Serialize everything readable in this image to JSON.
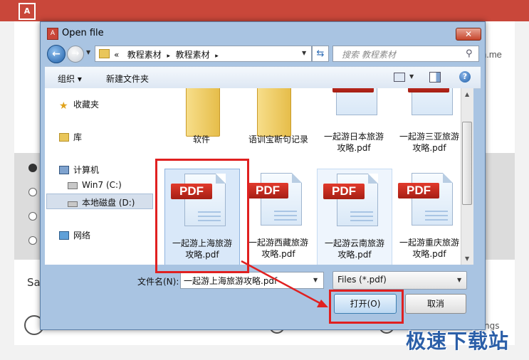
{
  "background_app": {
    "right_text": "n.me",
    "bottom_left_text": "Sa",
    "bottom_right_text": "ngs"
  },
  "dialog": {
    "title": "Open file",
    "close_label": "✕",
    "address": {
      "prefix": "«",
      "crumbs": [
        "教程素材",
        "教程素材"
      ],
      "separator": "▸"
    },
    "search_placeholder": "搜索 教程素材",
    "toolbar": {
      "organize_label": "组织 ▾",
      "new_folder_label": "新建文件夹"
    },
    "nav": {
      "favorites": "收藏夹",
      "libraries": "库",
      "computer": "计算机",
      "drive_c": "Win7 (C:)",
      "drive_d": "本地磁盘 (D:)",
      "network": "网络"
    },
    "files": [
      {
        "label": "软件",
        "type": "folder"
      },
      {
        "label": "语训宝断句记录",
        "type": "folder"
      },
      {
        "label": "一起游日本旅游攻略.pdf",
        "line1": "一起游日本旅游",
        "line2": "攻略.pdf",
        "type": "pdf"
      },
      {
        "label": "一起游三亚旅游攻略.pdf",
        "line1": "一起游三亚旅游",
        "line2": "攻略.pdf",
        "type": "pdf"
      },
      {
        "label": "一起游上海旅游攻略.pdf",
        "line1": "一起游上海旅游",
        "line2": "攻略.pdf",
        "type": "pdf",
        "selected": true
      },
      {
        "label": "一起游西藏旅游攻略.pdf",
        "line1": "一起游西藏旅游",
        "line2": "攻略.pdf",
        "type": "pdf"
      },
      {
        "label": "一起游云南旅游攻略.pdf",
        "line1": "一起游云南旅游",
        "line2": "攻略.pdf",
        "type": "pdf"
      },
      {
        "label": "一起游重庆旅游攻略.pdf",
        "line1": "一起游重庆旅游",
        "line2": "攻略.pdf",
        "type": "pdf"
      }
    ],
    "pdf_badge": "PDF",
    "filename_label": "文件名(N):",
    "filename_value": "一起游上海旅游攻略.pdf",
    "filter_value": "Files (*.pdf)",
    "open_label": "打开(O)",
    "cancel_label": "取消"
  },
  "watermark": "极速下载站",
  "colors": {
    "annotation_red": "#e02020",
    "app_red": "#c9473a",
    "dialog_frame": "#a9c4e2",
    "pdf_red": "#d02a1e"
  }
}
